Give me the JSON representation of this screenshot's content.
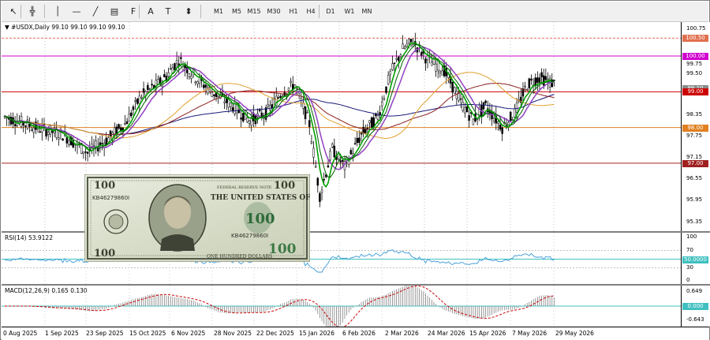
{
  "toolbar": {
    "tools": [
      {
        "name": "cursor",
        "glyph": "↖"
      },
      {
        "name": "crosshair",
        "glyph": "╬"
      },
      {
        "name": "vertical-line",
        "glyph": "│"
      },
      {
        "name": "horizontal-line",
        "glyph": "—"
      },
      {
        "name": "trend-line",
        "glyph": "╱"
      },
      {
        "name": "equidistant-channel",
        "glyph": "▤"
      },
      {
        "name": "fibonacci",
        "glyph": "F"
      },
      {
        "name": "text",
        "glyph": "A"
      },
      {
        "name": "text-label",
        "glyph": "T"
      },
      {
        "name": "arrows",
        "glyph": "⬍"
      }
    ],
    "timeframes": [
      "M1",
      "M5",
      "M15",
      "M30",
      "H1",
      "H4",
      "D1",
      "W1",
      "MN"
    ]
  },
  "main_chart": {
    "title": "#USDX,Daily  99.10 99.10 99.10 99.10",
    "price_labels": [
      "100.75",
      "100.50",
      "100.00",
      "99.75",
      "99.50",
      "99.00",
      "98.35",
      "98.00",
      "97.75",
      "97.15",
      "97.00",
      "96.55",
      "95.95",
      "95.35"
    ],
    "highlight_tags": [
      {
        "label": "100.50",
        "color": "#e07050"
      },
      {
        "label": "100.00",
        "color": "#d000d0"
      },
      {
        "label": "99.10",
        "color": "#888888"
      },
      {
        "label": "99.00",
        "color": "#cc0000"
      },
      {
        "label": "98.00",
        "color": "#e08020"
      },
      {
        "label": "97.00",
        "color": "#a02020"
      }
    ],
    "horizontal_levels": [
      {
        "price": 100.5,
        "color": "#e07050",
        "dashed": true
      },
      {
        "price": 100.0,
        "color": "#d000d0"
      },
      {
        "price": 99.0,
        "color": "#cc0000"
      },
      {
        "price": 98.0,
        "color": "#e08020"
      },
      {
        "price": 97.0,
        "color": "#a02020"
      }
    ]
  },
  "rsi": {
    "title": "RSI(14) 53.9122",
    "labels": [
      "100",
      "70",
      "50.0000",
      "30",
      "0"
    ],
    "level_tag": "50.0000"
  },
  "macd": {
    "title": "MACD(12,26,9) 0.165 0.130",
    "labels": [
      "0.649",
      "0.000",
      "-0.643"
    ],
    "zero_tag": "0.000"
  },
  "x_axis": [
    "0 Aug 2025",
    "1 Sep 2025",
    "23 Sep 2025",
    "15 Oct 2025",
    "6 Nov 2025",
    "28 Nov 2025",
    "22 Dec 2025",
    "15 Jan 2026",
    "6 Feb 2026",
    "2 Mar 2026",
    "24 Mar 2026",
    "15 Apr 2026",
    "7 May 2026",
    "29 May 2026"
  ],
  "banknote": {
    "serial": "KB46279860I",
    "denomination": "100",
    "header": "FEDERAL RESERVE NOTE",
    "country": "THE UNITED STATES OF AMERICA",
    "bottom": "ONE HUNDRED DOLLARS"
  },
  "colors": {
    "candle": "#000000",
    "green_ma": "#00a000",
    "purple_ma": "#9040c0",
    "navy_ma": "#1a1a7a",
    "brown_ma": "#8b2020",
    "orange_ma": "#e0a030",
    "rsi_line": "#3a9ad9",
    "macd_hist": "#808080",
    "macd_signal": "#cc0000"
  }
}
